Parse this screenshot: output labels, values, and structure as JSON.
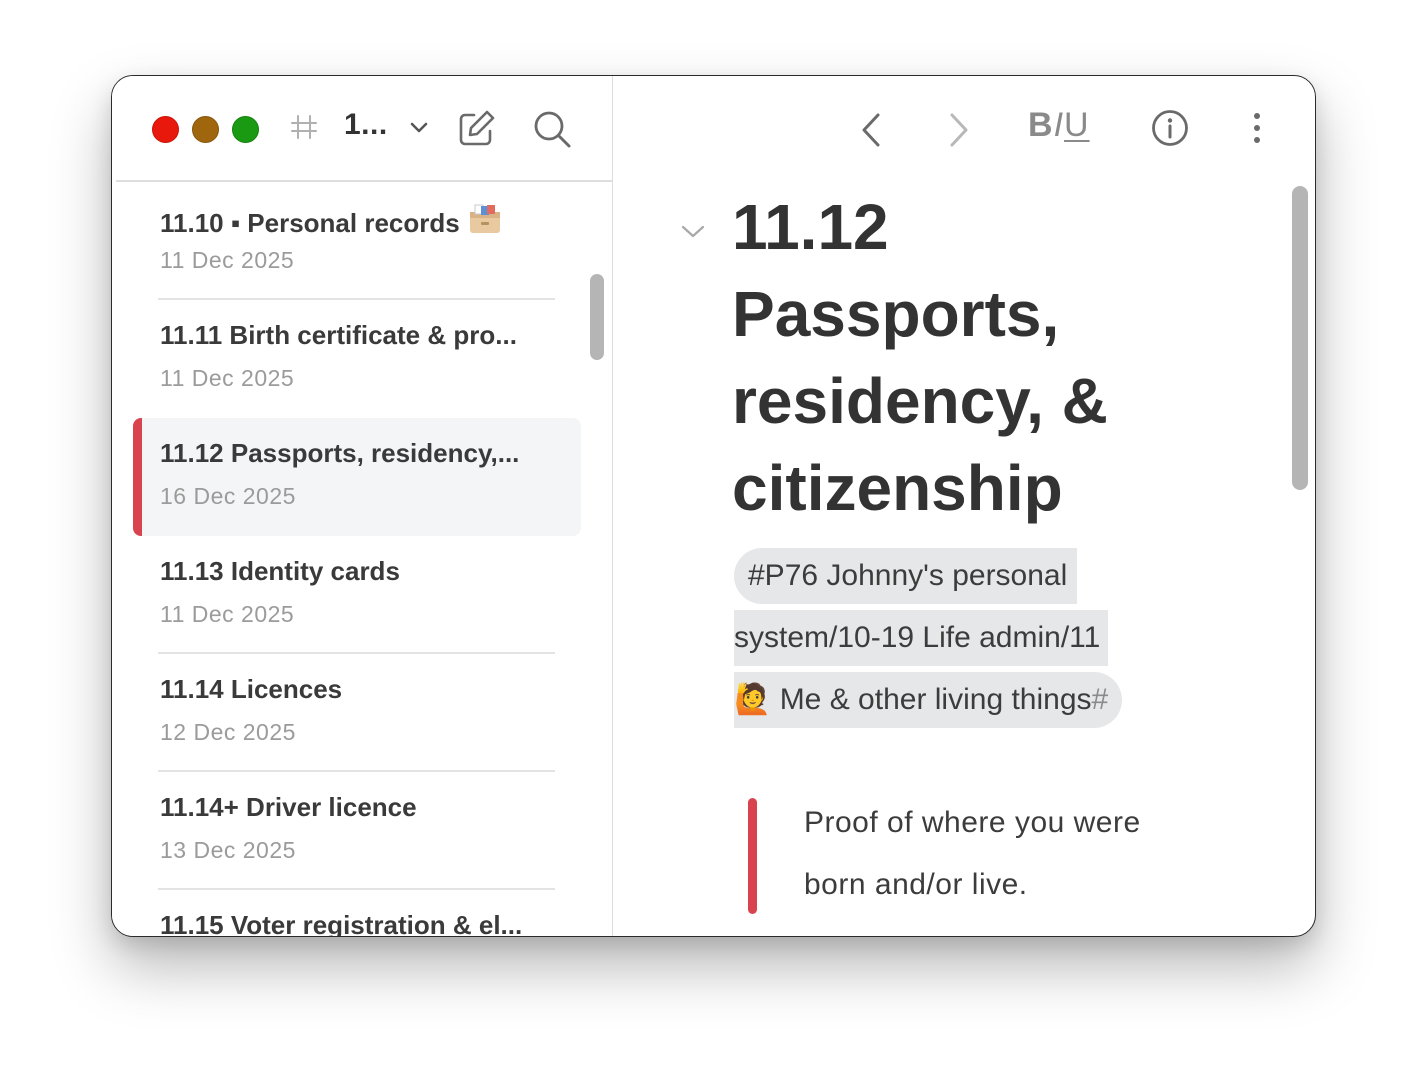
{
  "sidebar": {
    "notebook_title": "1...",
    "notes": [
      {
        "title": "11.10 ▪ Personal records",
        "date": "11 Dec 2025",
        "emoji": "card-file-box-icon",
        "selected": false
      },
      {
        "title": "11.11 Birth certificate & pro...",
        "date": "11 Dec 2025",
        "selected": false
      },
      {
        "title": "11.12 Passports, residency,...",
        "date": "16 Dec 2025",
        "selected": true
      },
      {
        "title": "11.13 Identity cards",
        "date": "11 Dec 2025",
        "selected": false
      },
      {
        "title": "11.14 Licences",
        "date": "12 Dec 2025",
        "selected": false
      },
      {
        "title": "11.14+ Driver licence",
        "date": "13 Dec 2025",
        "selected": false
      },
      {
        "title": "11.15 Voter registration & el...",
        "date": "",
        "selected": false
      }
    ]
  },
  "editor": {
    "format_bold": "B",
    "format_italic": "I",
    "format_underline": "U",
    "title_lines": [
      "11.12",
      "Passports,",
      "residency, &",
      "citizenship"
    ],
    "tag": {
      "line1": "#P76 Johnny's personal",
      "line2": "system/10-19 Life admin/11",
      "line3_emoji": "🙋",
      "line3_text": " Me & other living things",
      "line3_hash": "#"
    },
    "blockquote_lines": [
      "Proof of where you were",
      "born and/or live."
    ]
  },
  "colors": {
    "accent": "#d9434d",
    "traffic_red": "#e8180c",
    "traffic_yellow": "#a0660e",
    "traffic_green": "#1a9a12",
    "tag_background": "#e6e7e8",
    "selected_background": "#f4f5f6"
  }
}
